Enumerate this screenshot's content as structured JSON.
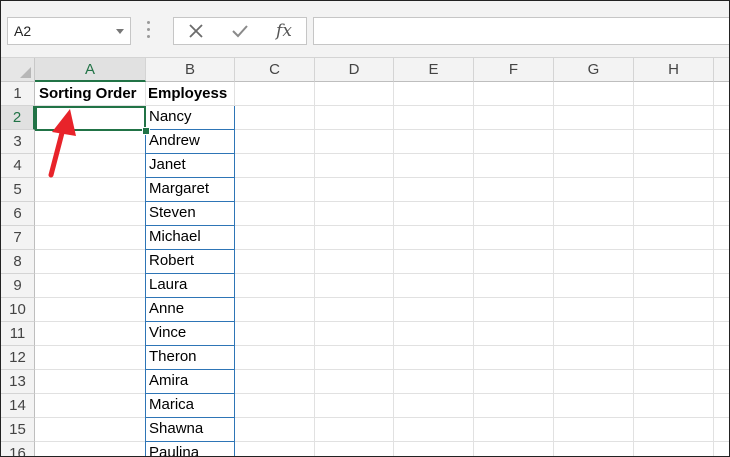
{
  "formula_bar": {
    "name_box": "A2",
    "cancel_icon": "cancel-x-icon",
    "enter_icon": "enter-check-icon",
    "function_label": "fx",
    "formula_value": ""
  },
  "columns": [
    "A",
    "B",
    "C",
    "D",
    "E",
    "F",
    "G",
    "H"
  ],
  "selected_column": "A",
  "rows": [
    "1",
    "2",
    "3",
    "4",
    "5",
    "6",
    "7",
    "8",
    "9",
    "10",
    "11",
    "12",
    "13",
    "14",
    "15",
    "16"
  ],
  "selected_row": "2",
  "cells": {
    "A1": "Sorting Order",
    "B1": "Employess",
    "B2": "Nancy",
    "B3": "Andrew",
    "B4": "Janet",
    "B5": "Margaret",
    "B6": "Steven",
    "B7": "Michael",
    "B8": "Robert",
    "B9": "Laura",
    "B10": "Anne",
    "B11": "Vince",
    "B12": "Theron",
    "B13": "Amira",
    "B14": "Marica",
    "B15": "Shawna",
    "B16": "Paulina"
  },
  "annotation": {
    "arrow_color": "#e8232a"
  },
  "colors": {
    "accent": "#217346",
    "border_blue": "#2e75b6"
  }
}
